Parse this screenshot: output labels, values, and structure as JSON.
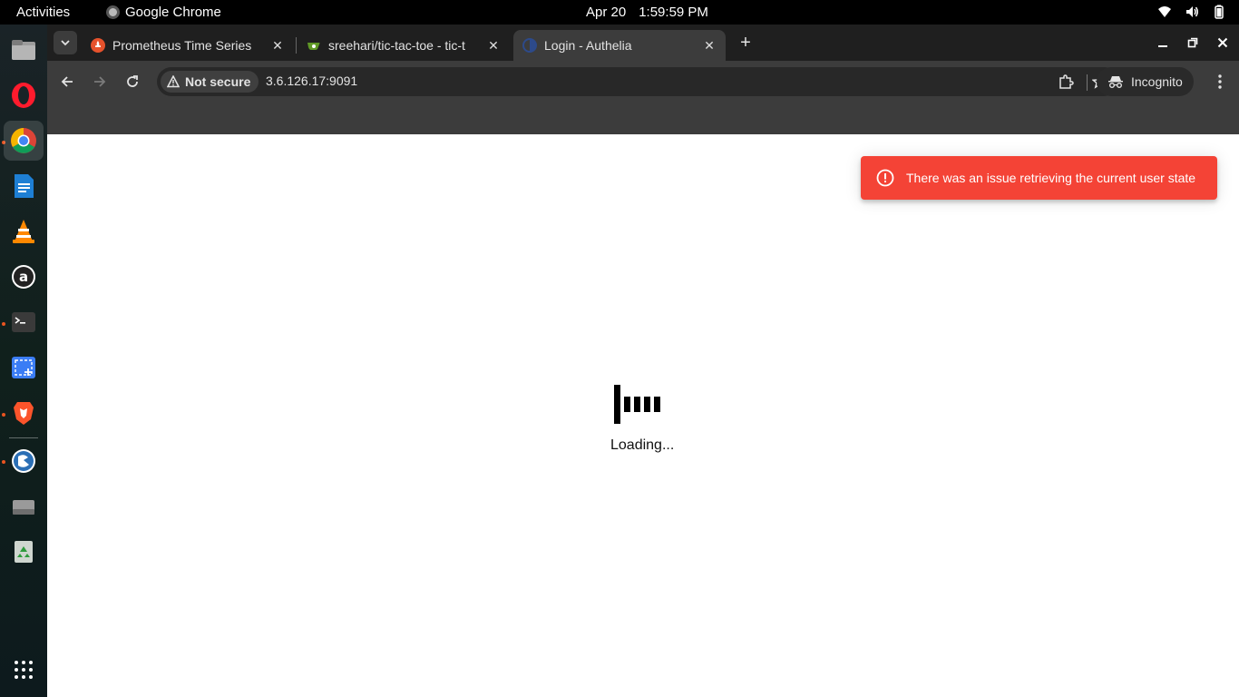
{
  "system": {
    "activities_label": "Activities",
    "app_name": "Google Chrome",
    "date": "Apr 20",
    "time": "1:59:59 PM"
  },
  "dock": {
    "items": [
      "files-icon",
      "opera-icon",
      "chrome-icon",
      "libreoffice-writer-icon",
      "vlc-icon",
      "amazon-icon",
      "terminal-icon",
      "screenshot-icon",
      "brave-icon",
      "pycharm-icon",
      "drive-icon",
      "trash-icon",
      "app-grid-icon"
    ]
  },
  "browser": {
    "tabs": [
      {
        "title": "Prometheus Time Series",
        "favicon": "prometheus-icon",
        "active": false
      },
      {
        "title": "sreehari/tic-tac-toe - tic-t",
        "favicon": "gitea-icon",
        "active": false
      },
      {
        "title": "Login - Authelia",
        "favicon": "authelia-icon",
        "active": true
      }
    ],
    "security_label": "Not secure",
    "url": "3.6.126.17:9091",
    "profile_label": "Incognito"
  },
  "page": {
    "error_message": "There was an issue retrieving the current user state",
    "loading_text": "Loading...",
    "error_color": "#f44336"
  }
}
